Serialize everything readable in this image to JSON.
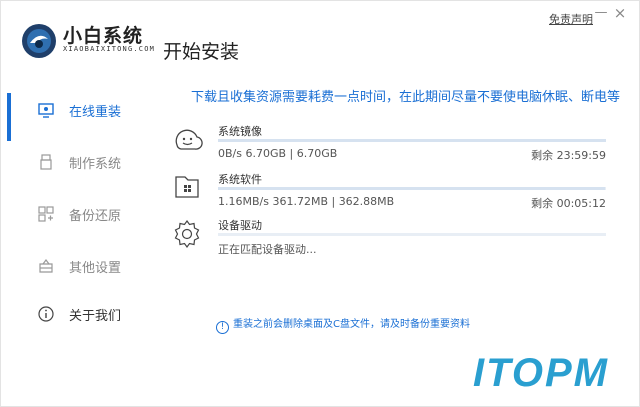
{
  "app": {
    "brand": "小白系统",
    "brand_sub": "XIAOBAIXITONG.COM",
    "title": "开始安装",
    "disclaimer": "免责声明",
    "minimize": "—",
    "close": "×"
  },
  "sidebar": {
    "items": [
      {
        "label": "在线重装",
        "icon": "monitor-icon",
        "active": true
      },
      {
        "label": "制作系统",
        "icon": "usb-icon",
        "active": false
      },
      {
        "label": "备份还原",
        "icon": "backup-icon",
        "active": false
      },
      {
        "label": "其他设置",
        "icon": "settings-box-icon",
        "active": false
      },
      {
        "label": "关于我们",
        "icon": "info-icon",
        "active": false
      }
    ]
  },
  "main": {
    "notice": "下载且收集资源需要耗费一点时间，在此期间尽量不要使电脑休眠、断电等",
    "tasks": [
      {
        "name": "系统镜像",
        "stats": "0B/s 6.70GB | 6.70GB",
        "remain": "剩余 23:59:59",
        "icon": "smiley-cloud-icon",
        "progress": 1.0
      },
      {
        "name": "系统软件",
        "stats": "1.16MB/s 361.72MB | 362.88MB",
        "remain": "剩余 00:05:12",
        "icon": "software-folder-icon",
        "progress": 0.997
      },
      {
        "name": "设备驱动",
        "stats": "正在匹配设备驱动...",
        "remain": "",
        "icon": "gear-icon",
        "progress": 0.0
      }
    ],
    "tip": "重装之前会删除桌面及C盘文件，请及时备份重要资料",
    "tip_icon": "!"
  },
  "watermark": "ITOPM",
  "colors": {
    "accent": "#1a6fd4",
    "track": "#e8eef5",
    "watermark": "#2a9fd0"
  }
}
